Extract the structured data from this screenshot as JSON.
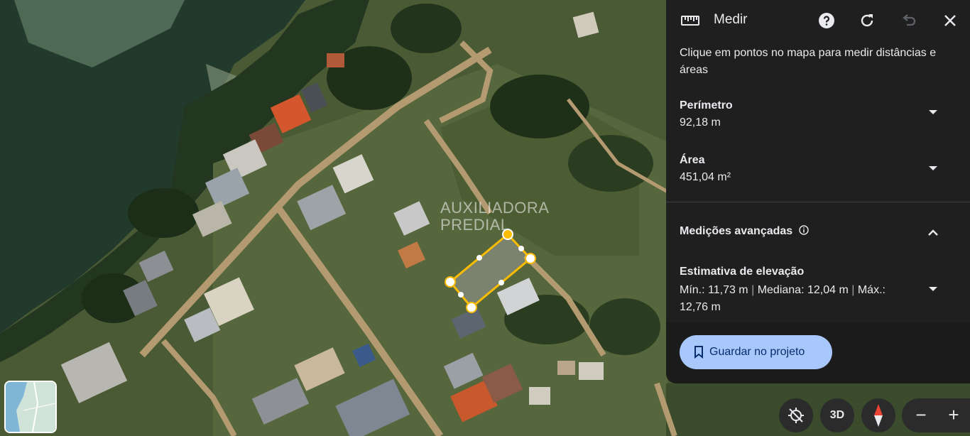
{
  "header": {
    "title": "Medir",
    "icons": [
      "ruler-icon",
      "help-icon",
      "refresh-icon",
      "undo-icon",
      "close-icon"
    ]
  },
  "instructions": "Clique em pontos no mapa para medir distâncias e áreas",
  "perimeter": {
    "label": "Perímetro",
    "value": "92,18 m"
  },
  "area": {
    "label": "Área",
    "value": "451,04 m²"
  },
  "advanced": {
    "label": "Medições avançadas"
  },
  "elevation": {
    "label": "Estimativa de elevação",
    "min": "Mín.: 11,73 m",
    "median": "Mediana: 12,04 m",
    "max": "Máx.: 12,76 m",
    "separator": "|"
  },
  "save": {
    "label": "Guardar no projeto"
  },
  "map_controls": {
    "three_d_label": "3D",
    "zoom_out": "−",
    "zoom_in": "+"
  },
  "watermark": {
    "line1": "AUXILIADORA",
    "line2": "PREDIAL"
  },
  "colors": {
    "panel_bg": "#1f1f1f",
    "accent": "#a8c7fa",
    "polygon": "#fbbc04"
  }
}
